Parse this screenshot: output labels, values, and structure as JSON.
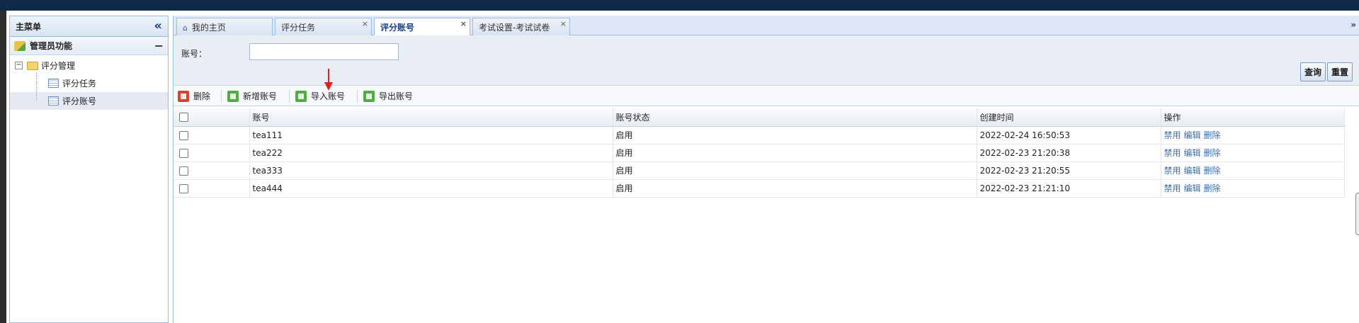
{
  "sidebar": {
    "title": "主菜单",
    "collapse_icon": "«",
    "section": {
      "title": "管理员功能",
      "minus": "−"
    },
    "tree": {
      "expander": "−",
      "root_label": "评分管理",
      "items": [
        {
          "label": "评分任务"
        },
        {
          "label": "评分账号"
        }
      ]
    }
  },
  "tabs": [
    {
      "label": "我的主页",
      "close": ""
    },
    {
      "label": "评分任务",
      "close": "×"
    },
    {
      "label": "评分账号",
      "close": "×"
    },
    {
      "label": "考试设置-考试试卷",
      "close": "×"
    }
  ],
  "tab_scroll_icon": "»",
  "search": {
    "label": "账号：",
    "value": "",
    "query_button": "查询",
    "reset_button": "重置"
  },
  "toolbar": {
    "delete": "删除",
    "add": "新增账号",
    "import": "导入账号",
    "export": "导出账号"
  },
  "grid": {
    "headers": [
      "账号",
      "账号状态",
      "创建时间",
      "操作"
    ],
    "rows": [
      {
        "account": "tea111",
        "status": "启用",
        "created": "2022-02-24 16:50:53"
      },
      {
        "account": "tea222",
        "status": "启用",
        "created": "2022-02-23 21:20:38"
      },
      {
        "account": "tea333",
        "status": "启用",
        "created": "2022-02-23 21:20:55"
      },
      {
        "account": "tea444",
        "status": "启用",
        "created": "2022-02-23 21:21:10"
      }
    ],
    "ops": {
      "disable": "禁用",
      "edit": "编辑",
      "delete": "删除"
    }
  },
  "colors": {
    "topbar": "#0e2a48",
    "border": "#99bbe8",
    "link": "#3b6ea5",
    "annotation_arrow": "#e02020"
  }
}
